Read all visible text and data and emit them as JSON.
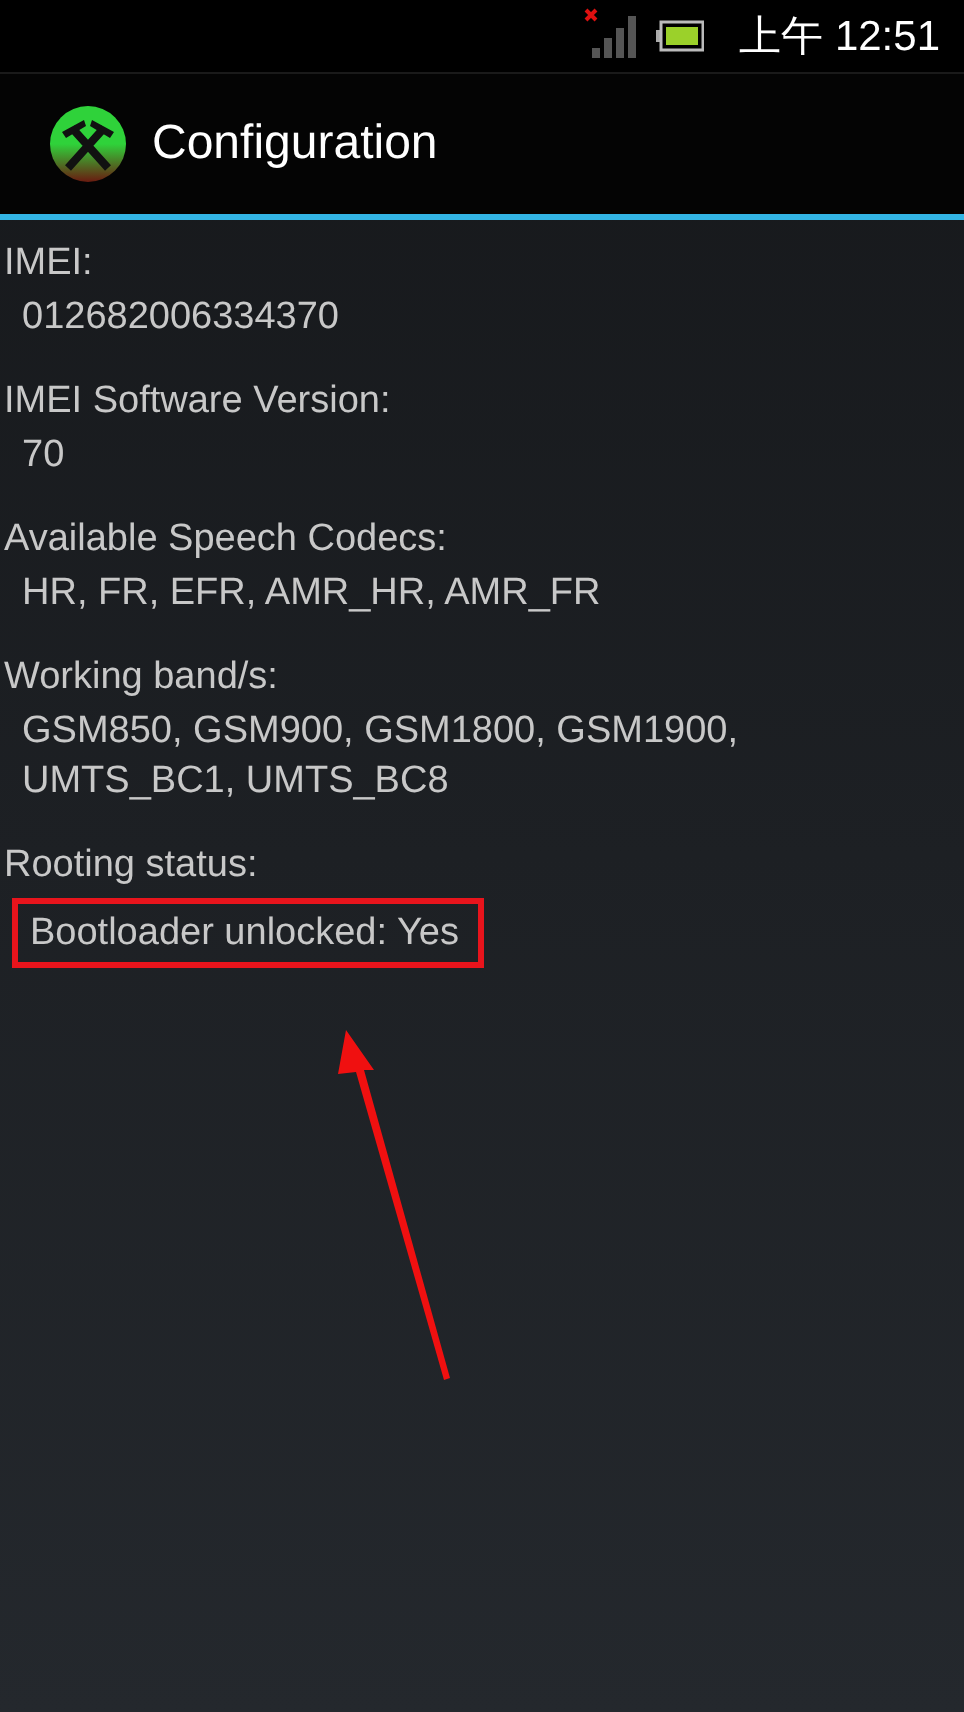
{
  "status_bar": {
    "time": "上午 12:51",
    "no_signal": true
  },
  "action_bar": {
    "title": "Configuration"
  },
  "sections": [
    {
      "label": "IMEI:",
      "values": [
        "012682006334370"
      ],
      "highlighted": false
    },
    {
      "label": "IMEI Software Version:",
      "values": [
        "70"
      ],
      "highlighted": false
    },
    {
      "label": "Available Speech Codecs:",
      "values": [
        "HR, FR, EFR, AMR_HR, AMR_FR"
      ],
      "highlighted": false
    },
    {
      "label": "Working band/s:",
      "values": [
        "GSM850, GSM900, GSM1800, GSM1900,",
        "UMTS_BC1, UMTS_BC8"
      ],
      "highlighted": false
    },
    {
      "label": "Rooting status:",
      "values": [
        "Bootloader unlocked: Yes"
      ],
      "highlighted": true
    }
  ],
  "annotation": {
    "arrow": true
  }
}
